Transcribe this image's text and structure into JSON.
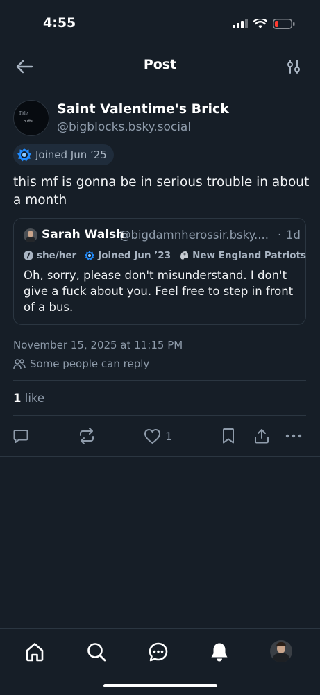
{
  "status_bar": {
    "time": "4:55"
  },
  "header": {
    "title": "Post"
  },
  "post": {
    "author_display_name": "Saint Valentime's Brick",
    "author_handle": "@bigblocks.bsky.social",
    "avatar_text_1": "Title",
    "avatar_text_2": "butts",
    "joined_badge": "Joined Jun ’25",
    "text": "this mf is gonna be in serious trouble in about a month",
    "timestamp": "November 15, 2025 at 11:15 PM",
    "reply_setting": "Some people can reply",
    "like_count": "1",
    "like_label": " like"
  },
  "quote": {
    "author_name": "Sarah Walsh",
    "author_handle": "@bigdamnherossir.bsky....",
    "separator": "·",
    "time_ago": "1d",
    "tags": {
      "pronouns": "she/her",
      "joined": "Joined Jun ’23",
      "team": "New England Patriots"
    },
    "text": "Oh, sorry, please don't misunderstand. I don't give a fuck about you. Feel free to step in front of a bus."
  },
  "actions": {
    "like_count": "1"
  },
  "colors": {
    "background": "#161e27",
    "divider": "#2b3641",
    "muted_text": "#8e9baa",
    "badge_bg": "#1f2c3b",
    "badge_icon": "#208bfe",
    "battery_low": "#ff3b30"
  },
  "icons": {
    "back": "arrow-left-icon",
    "filter": "sliders-icon",
    "joined": "starburst-badge-icon",
    "reply_setting": "people-icon",
    "reply": "speech-bubble-icon",
    "repost": "repost-icon",
    "like": "heart-icon",
    "bookmark": "bookmark-icon",
    "share": "share-icon",
    "more": "ellipsis-icon",
    "tab_home": "home-icon",
    "tab_search": "search-icon",
    "tab_chat": "chat-icon",
    "tab_notifications": "bell-icon"
  }
}
